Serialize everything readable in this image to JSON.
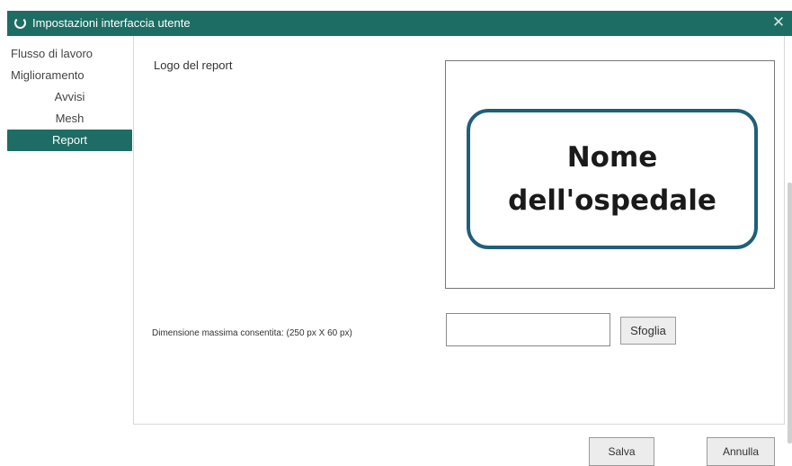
{
  "window": {
    "title": "Impostazioni interfaccia utente",
    "close_glyph": "✕"
  },
  "sidebar": {
    "items": [
      {
        "label": "Flusso di lavoro",
        "active": false
      },
      {
        "label": "Miglioramento",
        "active": false
      },
      {
        "label": "Avvisi",
        "active": false
      },
      {
        "label": "Mesh",
        "active": false
      },
      {
        "label": "Report",
        "active": true
      }
    ]
  },
  "report": {
    "logo_label": "Logo del report",
    "logo_preview_text": "Nome\ndell'ospedale",
    "size_hint": "Dimensione massima consentita: (250 px X 60 px)",
    "file_path_value": "",
    "browse_label": "Sfoglia"
  },
  "footer": {
    "save_label": "Salva",
    "cancel_label": "Annulla"
  },
  "colors": {
    "accent": "#1d6d64",
    "logo_border": "#1f5f7a"
  },
  "icons": {
    "app": "loading-ring-icon",
    "close": "close-icon"
  }
}
